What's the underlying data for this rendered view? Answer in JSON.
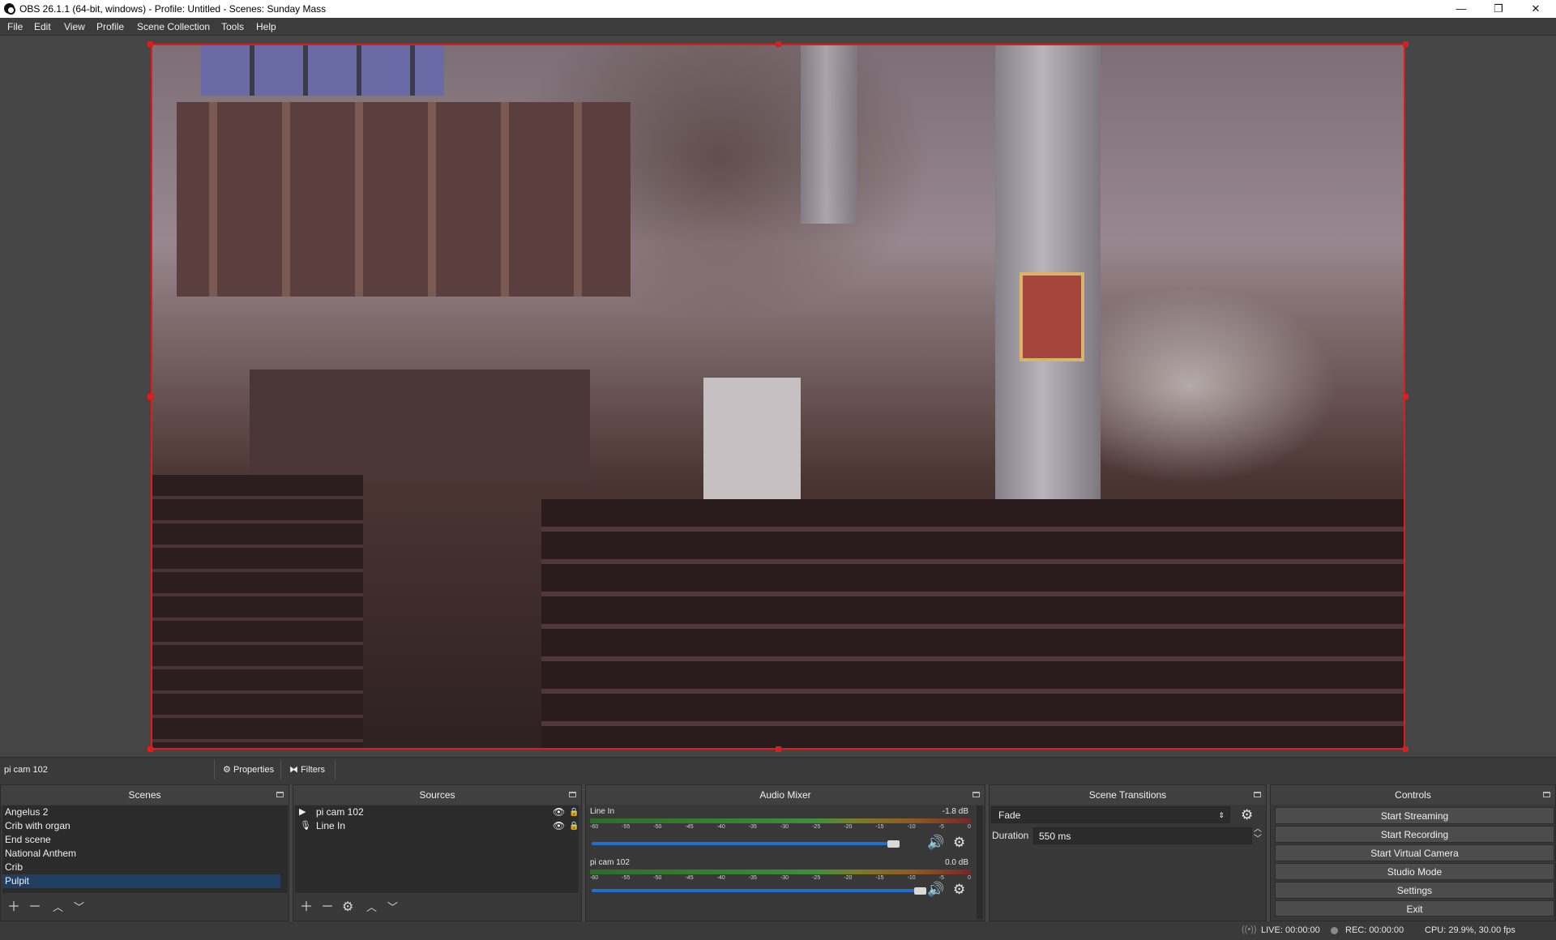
{
  "window": {
    "title": "OBS 26.1.1 (64-bit, windows) - Profile: Untitled - Scenes: Sunday Mass",
    "minimize": "—",
    "restore": "❐",
    "close": "✕"
  },
  "menu": {
    "items": [
      "File",
      "Edit",
      "View",
      "Profile",
      "Scene Collection",
      "Tools",
      "Help"
    ]
  },
  "preview": {
    "selected_source": "pi cam 102",
    "properties_label": "Properties",
    "filters_label": "Filters"
  },
  "scenes": {
    "title": "Scenes",
    "items": [
      "Angelus 2",
      "Crib with organ",
      "End scene",
      "National Anthem",
      "Crib",
      "Pulpit"
    ],
    "selected": "Pulpit"
  },
  "sources": {
    "title": "Sources",
    "items": [
      {
        "name": "pi cam 102",
        "icon": "play-icon"
      },
      {
        "name": "Line In",
        "icon": "microphone-icon"
      }
    ]
  },
  "audio_mixer": {
    "title": "Audio Mixer",
    "scale_labels": [
      "-60",
      "-55",
      "-50",
      "-45",
      "-40",
      "-35",
      "-30",
      "-25",
      "-20",
      "-15",
      "-10",
      "-5",
      "0"
    ],
    "channels": [
      {
        "name": "Line In",
        "db": "-1.8 dB",
        "fader_level": 0.92
      },
      {
        "name": "pi cam 102",
        "db": "0.0 dB",
        "fader_level": 1.0
      }
    ]
  },
  "scene_transitions": {
    "title": "Scene Transitions",
    "transition": "Fade",
    "duration_label": "Duration",
    "duration_value": "550 ms"
  },
  "controls": {
    "title": "Controls",
    "buttons": [
      "Start Streaming",
      "Start Recording",
      "Start Virtual Camera",
      "Studio Mode",
      "Settings",
      "Exit"
    ]
  },
  "status": {
    "live": "LIVE: 00:00:00",
    "rec": "REC: 00:00:00",
    "cpu": "CPU: 29.9%, 30.00 fps"
  },
  "colors": {
    "selection_border": "#e01b1b",
    "selected_row": "#1f3e62",
    "fader": "#1f6fd1"
  }
}
